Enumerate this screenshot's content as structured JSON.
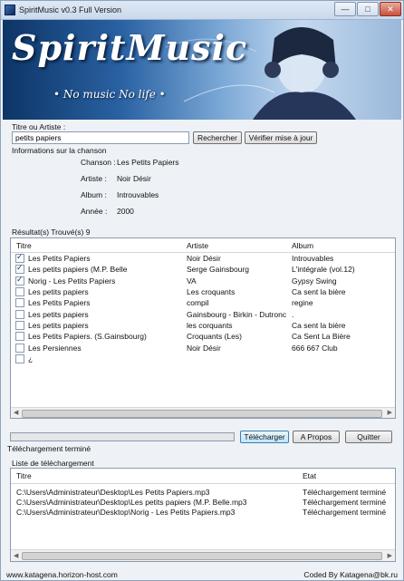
{
  "window": {
    "title": "SpiritMusic v0.3 Full Version"
  },
  "banner": {
    "logo": "SpiritMusic",
    "slogan": "• No music No life •"
  },
  "search": {
    "label": "Titre ou Artiste :",
    "value": "petits papiers",
    "search_button": "Rechercher",
    "update_button": "Vérifier mise à jour"
  },
  "info": {
    "label": "Informations sur la chanson",
    "rows": [
      {
        "key": "Chanson :",
        "value": "Les Petits Papiers"
      },
      {
        "key": "Artiste :",
        "value": "Noir Désir"
      },
      {
        "key": "Album :",
        "value": "Introuvables"
      },
      {
        "key": "Année :",
        "value": "2000"
      }
    ]
  },
  "results": {
    "label": "Résultat(s) Trouvé(s) 9",
    "columns": [
      "Titre",
      "Artiste",
      "Album"
    ],
    "rows": [
      {
        "checked": true,
        "title": "Les Petits Papiers",
        "artist": "Noir Désir",
        "album": "Introuvables"
      },
      {
        "checked": true,
        "title": "Les petits papiers (M.P. Belle",
        "artist": "Serge Gainsbourg",
        "album": "L'intégrale (vol.12)"
      },
      {
        "checked": true,
        "title": "Norig - Les Petits Papiers",
        "artist": "VA",
        "album": "Gypsy Swing"
      },
      {
        "checked": false,
        "title": "Les petits papiers",
        "artist": "Les croquants",
        "album": "Ca sent la bière"
      },
      {
        "checked": false,
        "title": "Les Petits Papiers",
        "artist": "compil",
        "album": "regine"
      },
      {
        "checked": false,
        "title": "Les petits papiers",
        "artist": "Gainsbourg - Birkin - Dutronc",
        "album": "."
      },
      {
        "checked": false,
        "title": "Les petits papiers",
        "artist": "les corquants",
        "album": "Ca sent la bière"
      },
      {
        "checked": false,
        "title": "Les Petits Papiers. (S.Gainsbourg)",
        "artist": "Croquants (Les)",
        "album": "Ca Sent La Bière"
      },
      {
        "checked": false,
        "title": "Les Persiennes",
        "artist": "Noir Désir",
        "album": "666 667 Club"
      },
      {
        "checked": false,
        "title": "¿",
        "artist": "",
        "album": ""
      }
    ]
  },
  "actions": {
    "download": "Télécharger",
    "about": "A Propos",
    "quit": "Quitter"
  },
  "progress": {
    "value": 0
  },
  "status": "Téléchargement terminé",
  "downloads": {
    "label": "Liste de téléchargement",
    "columns": [
      "Titre",
      "Etat"
    ],
    "rows": [
      {
        "path": "C:\\Users\\Administrateur\\Desktop\\Les Petits Papiers.mp3",
        "state": "Téléchargement terminé"
      },
      {
        "path": "C:\\Users\\Administrateur\\Desktop\\Les petits papiers (M.P. Belle.mp3",
        "state": "Téléchargement terminé"
      },
      {
        "path": "C:\\Users\\Administrateur\\Desktop\\Norig - Les Petits Papiers.mp3",
        "state": "Téléchargement terminé"
      }
    ]
  },
  "footer": {
    "left": "www.katagena.horizon-host.com",
    "right": "Coded By Katagena@bk.ru"
  },
  "colors": {
    "accent": "#3c7fb1",
    "banner_dark": "#0d3566"
  }
}
